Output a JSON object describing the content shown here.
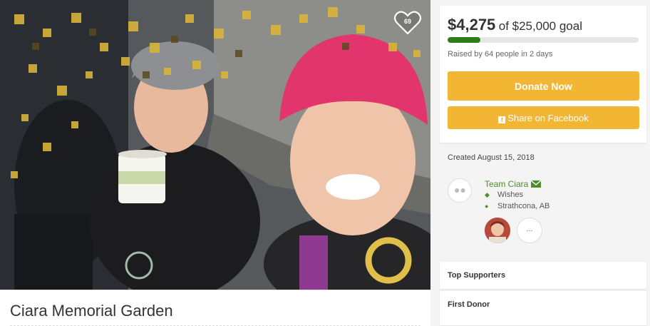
{
  "campaign": {
    "title": "Ciara Memorial Garden",
    "likes": "69"
  },
  "donation": {
    "raised": "$4,275",
    "goal_text": "of $25,000 goal",
    "progress_fraction": 0.171,
    "raised_by": "Raised by 64 people in 2 days",
    "donate_label": "Donate Now",
    "share_label": "Share on Facebook",
    "share_icon": "facebook-icon"
  },
  "organizer": {
    "created": "Created August 15, 2018",
    "team": "Team Ciara",
    "category": "Wishes",
    "location": "Strathcona, AB",
    "more_label": "..."
  },
  "sections": {
    "top_supporters": "Top Supporters",
    "first_donor": "First Donor"
  },
  "colors": {
    "accent": "#f2b634",
    "progress": "#2f7c1d",
    "link": "#4c8c2a"
  }
}
